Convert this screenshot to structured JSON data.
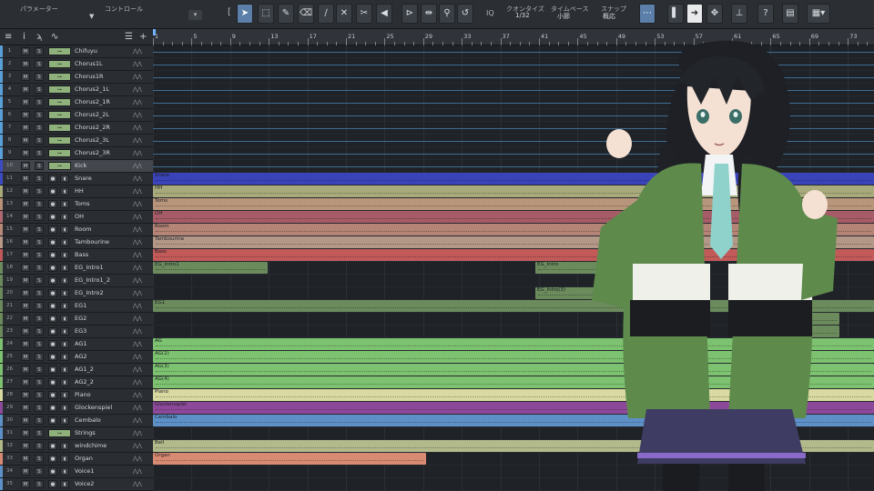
{
  "toolbar": {
    "param_label": "パラメーター",
    "control_label": "コントロール",
    "quantize_label": "クオンタイズ",
    "quantize_value": "1/32",
    "timebase_label": "タイムベース",
    "timebase_value": "小節",
    "snap_label": "スナップ",
    "snap_value": "概応",
    "iq_label": "IQ"
  },
  "ruler": {
    "bars": [
      "1",
      "5",
      "9",
      "13",
      "17",
      "21",
      "25",
      "29",
      "33",
      "37",
      "41",
      "45",
      "49",
      "53",
      "57",
      "61",
      "65",
      "69",
      "73"
    ]
  },
  "tracks": [
    {
      "num": "1",
      "name": "Chifuyu",
      "type": "inst",
      "color": "#5aa0d8"
    },
    {
      "num": "2",
      "name": "Chorus1L",
      "type": "inst",
      "color": "#5aa0d8"
    },
    {
      "num": "3",
      "name": "Chorus1R",
      "type": "inst",
      "color": "#5aa0d8"
    },
    {
      "num": "4",
      "name": "Chorus2_1L",
      "type": "inst",
      "color": "#5aa0d8"
    },
    {
      "num": "5",
      "name": "Chorus2_1R",
      "type": "inst",
      "color": "#5aa0d8"
    },
    {
      "num": "6",
      "name": "Chorus2_2L",
      "type": "inst",
      "color": "#5aa0d8"
    },
    {
      "num": "7",
      "name": "Chorus2_2R",
      "type": "inst",
      "color": "#5aa0d8"
    },
    {
      "num": "8",
      "name": "Chorus2_3L",
      "type": "inst",
      "color": "#5aa0d8"
    },
    {
      "num": "9",
      "name": "Chorus2_3R",
      "type": "inst",
      "color": "#5aa0d8"
    },
    {
      "num": "10",
      "name": "Kick",
      "type": "inst",
      "color": "#3c4ac4"
    },
    {
      "num": "11",
      "name": "Snare",
      "type": "audio",
      "color": "#3c4ac4"
    },
    {
      "num": "12",
      "name": "HH",
      "type": "audio",
      "color": "#a8a878"
    },
    {
      "num": "13",
      "name": "Toms",
      "type": "audio",
      "color": "#b89078"
    },
    {
      "num": "14",
      "name": "OH",
      "type": "audio",
      "color": "#b06870"
    },
    {
      "num": "15",
      "name": "Room",
      "type": "audio",
      "color": "#b88878"
    },
    {
      "num": "16",
      "name": "Tambourine",
      "type": "audio",
      "color": "#b89888"
    },
    {
      "num": "17",
      "name": "Bass",
      "type": "audio",
      "color": "#c05858"
    },
    {
      "num": "18",
      "name": "EG_Intro1",
      "type": "audio",
      "color": "#6a8a5c"
    },
    {
      "num": "19",
      "name": "EG_Intro1_2",
      "type": "audio",
      "color": "#6a8a5c"
    },
    {
      "num": "20",
      "name": "EG_Intro2",
      "type": "audio",
      "color": "#6a8a5c"
    },
    {
      "num": "21",
      "name": "EG1",
      "type": "audio",
      "color": "#6a8a5c"
    },
    {
      "num": "22",
      "name": "EG2",
      "type": "audio",
      "color": "#6a8a5c"
    },
    {
      "num": "23",
      "name": "EG3",
      "type": "audio",
      "color": "#6a8a5c"
    },
    {
      "num": "24",
      "name": "AG1",
      "type": "audio",
      "color": "#7cc070"
    },
    {
      "num": "25",
      "name": "AG2",
      "type": "audio",
      "color": "#7cc070"
    },
    {
      "num": "26",
      "name": "AG1_2",
      "type": "audio",
      "color": "#7cc070"
    },
    {
      "num": "27",
      "name": "AG2_2",
      "type": "audio",
      "color": "#7cc070"
    },
    {
      "num": "28",
      "name": "Piano",
      "type": "audio",
      "color": "#d8d8a0"
    },
    {
      "num": "29",
      "name": "Glockenspiel",
      "type": "audio",
      "color": "#8e4a9a"
    },
    {
      "num": "30",
      "name": "Cembalo",
      "type": "audio",
      "color": "#5e90c8"
    },
    {
      "num": "31",
      "name": "Strings",
      "type": "inst",
      "color": "#5e90c8"
    },
    {
      "num": "32",
      "name": "windchime",
      "type": "audio",
      "color": "#b0b888"
    },
    {
      "num": "33",
      "name": "Organ",
      "type": "audio",
      "color": "#d88870"
    },
    {
      "num": "34",
      "name": "Voice1",
      "type": "audio",
      "color": "#5e90c8"
    },
    {
      "num": "35",
      "name": "Voice2",
      "type": "audio",
      "color": "#5e90c8"
    }
  ],
  "clips": [
    {
      "track": 11,
      "label": "Snare",
      "start": 0,
      "end": 792,
      "color": "#3a44b8"
    },
    {
      "track": 12,
      "label": "HH",
      "start": 0,
      "end": 792,
      "color": "#a8aa7c"
    },
    {
      "track": 13,
      "label": "Toms",
      "start": 0,
      "end": 792,
      "color": "#b8967c"
    },
    {
      "track": 14,
      "label": "OH",
      "start": 0,
      "end": 792,
      "color": "#a65c66"
    },
    {
      "track": 15,
      "label": "Room",
      "start": 0,
      "end": 792,
      "color": "#b48476"
    },
    {
      "track": 16,
      "label": "Tambourine",
      "start": 0,
      "end": 792,
      "color": "#b39888"
    },
    {
      "track": 17,
      "label": "Bass",
      "start": 0,
      "end": 792,
      "color": "#c25a5a"
    },
    {
      "track": 18,
      "label": "EG_Intro1",
      "start": 0,
      "end": 126,
      "color": "#6b8b5d"
    },
    {
      "track": 18,
      "label": "EG_Intro",
      "start": 420,
      "end": 520,
      "color": "#6b8b5d"
    },
    {
      "track": 20,
      "label": "EG_Intro(3)",
      "start": 420,
      "end": 560,
      "color": "#6b8b5d"
    },
    {
      "track": 21,
      "label": "EG1",
      "start": 0,
      "end": 792,
      "color": "#6b8b5d"
    },
    {
      "track": 22,
      "label": "",
      "start": 680,
      "end": 754,
      "color": "#6b8b5d"
    },
    {
      "track": 23,
      "label": "",
      "start": 680,
      "end": 754,
      "color": "#6b8b5d"
    },
    {
      "track": 24,
      "label": "AG",
      "start": 0,
      "end": 792,
      "color": "#7dc270"
    },
    {
      "track": 25,
      "label": "AG(2)",
      "start": 0,
      "end": 792,
      "color": "#7dc270"
    },
    {
      "track": 26,
      "label": "AG(3)",
      "start": 0,
      "end": 792,
      "color": "#7dc270"
    },
    {
      "track": 27,
      "label": "AG(4)",
      "start": 0,
      "end": 792,
      "color": "#7dc270"
    },
    {
      "track": 28,
      "label": "Piano",
      "start": 0,
      "end": 792,
      "color": "#d9d9a2"
    },
    {
      "track": 29,
      "label": "Glockenspiel",
      "start": 0,
      "end": 792,
      "color": "#8d4999"
    },
    {
      "track": 30,
      "label": "Cembalo",
      "start": 0,
      "end": 792,
      "color": "#5e90c8"
    },
    {
      "track": 32,
      "label": "Bell",
      "start": 0,
      "end": 792,
      "color": "#b2b98a"
    },
    {
      "track": 33,
      "label": "Organ",
      "start": 0,
      "end": 300,
      "color": "#d98a72"
    }
  ]
}
